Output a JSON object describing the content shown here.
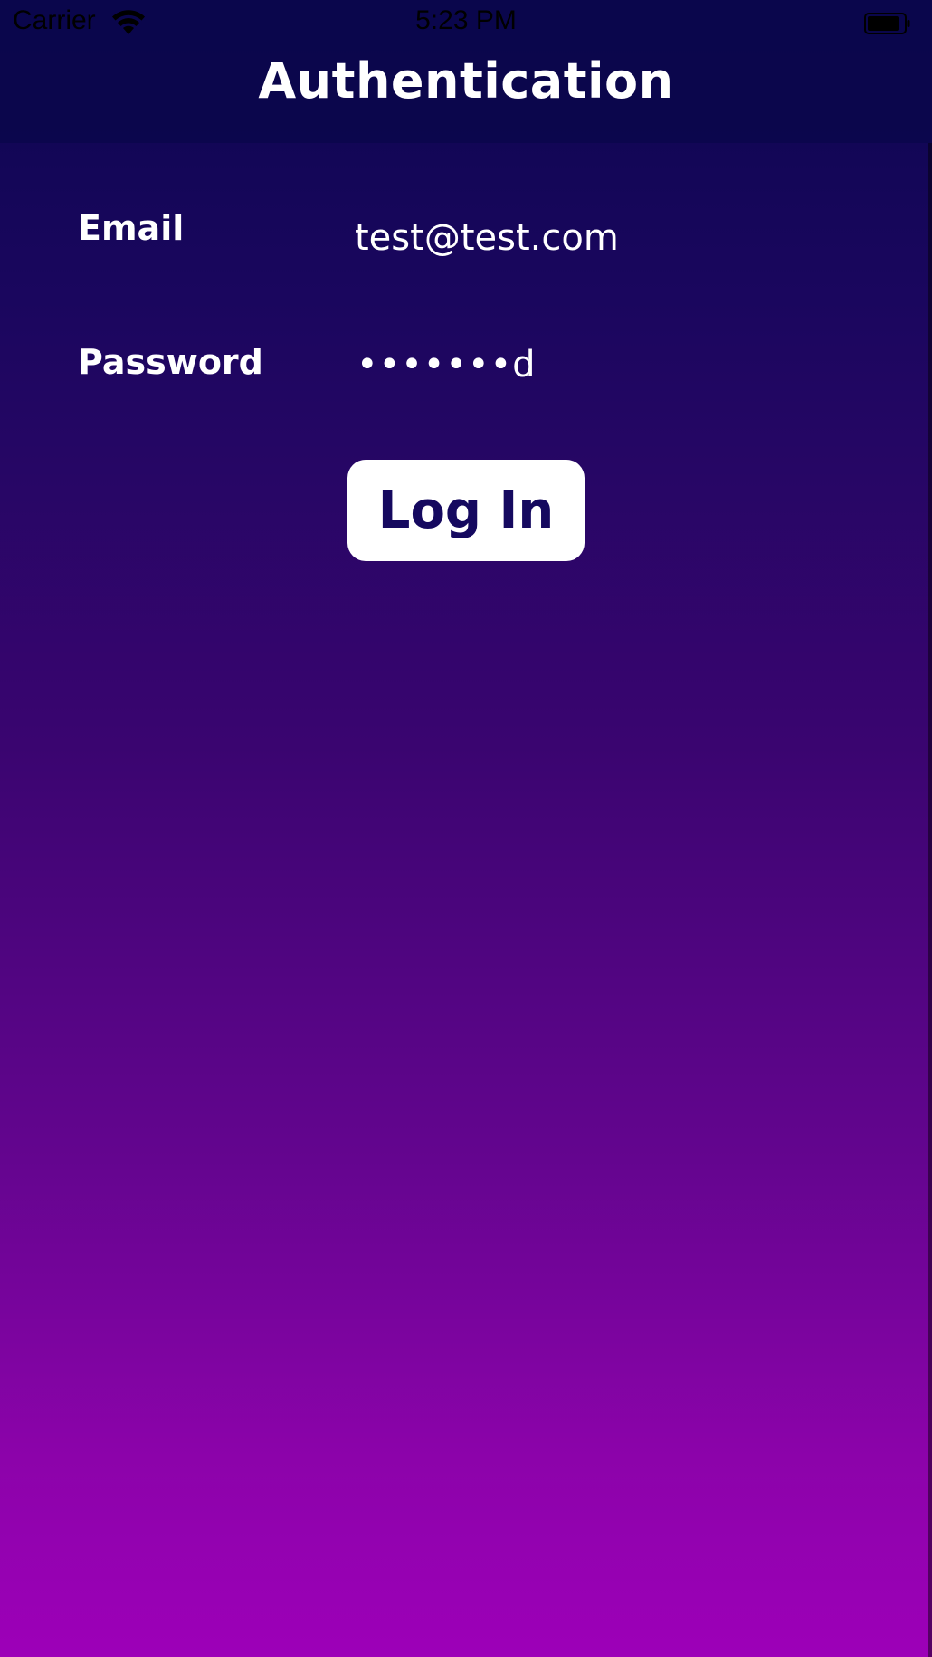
{
  "status_bar": {
    "carrier": "Carrier",
    "time": "5:23 PM",
    "icons": [
      "wifi-icon",
      "battery-icon"
    ]
  },
  "nav": {
    "title": "Authentication"
  },
  "form": {
    "email_label": "Email",
    "email_value": "test@test.com",
    "password_label": "Password",
    "password_value": "•••••••d"
  },
  "actions": {
    "login_label": "Log In"
  },
  "colors": {
    "gradient_top": "#0b074f",
    "gradient_bottom": "#9d00b8",
    "button_bg": "#ffffff",
    "button_text": "#15095f",
    "text": "#ffffff"
  }
}
